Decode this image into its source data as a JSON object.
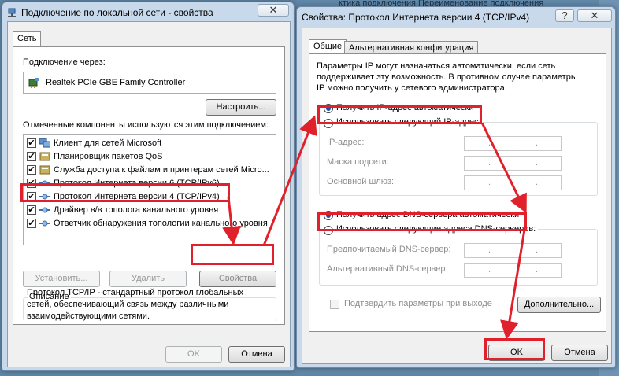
{
  "background": {
    "title": "ктика подключения      Переименование подключения"
  },
  "left_window": {
    "title": "Подключение по локальной сети - свойства",
    "close": "✕",
    "tab": "Сеть",
    "connect_using_label": "Подключение через:",
    "adapter_name": "Realtek PCIe GBE Family Controller",
    "configure_button": "Настроить...",
    "components_label": "Отмеченные компоненты используются этим подключением:",
    "components": [
      {
        "label": "Клиент для сетей Microsoft",
        "checked": "✔"
      },
      {
        "label": "Планировщик пакетов QoS",
        "checked": "✔"
      },
      {
        "label": "Служба доступа к файлам и принтерам сетей Micro...",
        "checked": "✔"
      },
      {
        "label": "Протокол Интернета версии 6 (TCP/IPv6)",
        "checked": "✔"
      },
      {
        "label": "Протокол Интернета версии 4 (TCP/IPv4)",
        "checked": "✔"
      },
      {
        "label": "Драйвер в/в тополога канального уровня",
        "checked": "✔"
      },
      {
        "label": "Ответчик обнаружения топологии канального уровня",
        "checked": "✔"
      }
    ],
    "install_button": "Установить...",
    "remove_button": "Удалить",
    "properties_button": "Свойства",
    "description_label": "Описание",
    "description_text_1": "Протокол TCP/IP - стандартный протокол глобальных",
    "description_text_2": "сетей, обеспечивающий связь между различными",
    "description_text_3": "взаимодействующими сетями.",
    "ok_button": "OK",
    "cancel_button": "Отмена"
  },
  "right_window": {
    "title": "Свойства: Протокол Интернета версии 4 (TCP/IPv4)",
    "help": "?",
    "close": "✕",
    "tab_general": "Общие",
    "tab_alternate": "Альтернативная конфигурация",
    "intro_1": "Параметры IP могут назначаться автоматически, если сеть",
    "intro_2": "поддерживает эту возможность. В противном случае параметры",
    "intro_3": "IP можно получить у сетевого администратора.",
    "radio_ip_auto": "Получить IP-адрес автоматически",
    "radio_ip_manual": "Использовать следующий IP-адрес:",
    "ip_label": "IP-адрес:",
    "mask_label": "Маска подсети:",
    "gateway_label": "Основной шлюз:",
    "radio_dns_auto": "Получить адрес DNS-сервера автоматически",
    "radio_dns_manual": "Использовать следующие адреса DNS-серверов:",
    "dns_pref_label": "Предпочитаемый DNS-сервер:",
    "dns_alt_label": "Альтернативный DNS-сервер:",
    "validate_label": "Подтвердить параметры при выходе",
    "advanced_button": "Дополнительно...",
    "ok_button": "OK",
    "cancel_button": "Отмена"
  },
  "colors": {
    "highlight": "#e0202b",
    "title_bar": "#c7d9ea",
    "accent": "#1a50a8"
  }
}
